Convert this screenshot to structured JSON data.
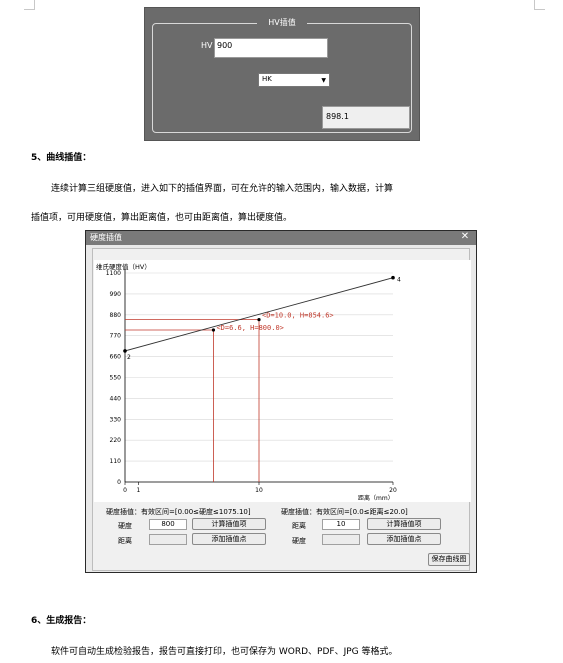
{
  "hv_panel": {
    "frame_title": "HV插值",
    "hv_label": "HV",
    "hv_value": "900",
    "scale_select": "HK",
    "result": "898.1"
  },
  "section5": {
    "heading": "5、曲线插值：",
    "para_line1": "连续计算三组硬度值，进入如下的插值界面，可在允许的输入范围内，输入数据，计算",
    "para_line2": "插值项，可用硬度值，算出距离值，也可由距离值，算出硬度值。"
  },
  "dialog": {
    "title": "硬度插值",
    "close_glyph": "✕",
    "left": {
      "header": "硬度插值：有效区间=[0.00≤硬度≤1075.10]",
      "hardness_label": "硬度",
      "hardness_value": "800",
      "calc_button": "计算插值项",
      "distance_label": "距离",
      "distance_value": "",
      "add_button": "添加插值点"
    },
    "right": {
      "header": "硬度插值：有效区间=[0.0≤距离≤20.0]",
      "distance_label": "距离",
      "distance_value": "10",
      "calc_button": "计算插值项",
      "hardness_label": "硬度",
      "hardness_value": "",
      "add_button": "添加插值点"
    },
    "save_button": "保存曲线图"
  },
  "chart_data": {
    "type": "line",
    "ylabel": "维氏硬度值（HV）",
    "xlabel": "距离（mm）",
    "ylim": [
      0,
      1100
    ],
    "xlim": [
      0,
      20
    ],
    "yticks": [
      "1100",
      "990",
      "880",
      "770",
      "660",
      "550",
      "440",
      "330",
      "220",
      "110",
      "0"
    ],
    "ytick_values": [
      1100,
      990,
      880,
      770,
      660,
      550,
      440,
      330,
      220,
      110,
      0
    ],
    "xticks": [
      "0",
      "1",
      "10",
      "20"
    ],
    "xtick_values": [
      0,
      1,
      10,
      20
    ],
    "series": [
      {
        "points": [
          {
            "x": 0,
            "y": 690,
            "label": "2"
          },
          {
            "x": 20,
            "y": 1075.1,
            "label": "4"
          }
        ]
      }
    ],
    "interpolations": [
      {
        "x": 10.0,
        "y": 854.6,
        "label": "<D=10.0, H=854.6>"
      },
      {
        "x": 6.6,
        "y": 800.0,
        "label": "<D=6.6, H=800.0>"
      }
    ],
    "colors": {
      "curve": "#333333",
      "interp": "#c0392b",
      "grid": "#d8d8d8"
    }
  },
  "section6": {
    "heading": "6、生成报告：",
    "para": "软件可自动生成检验报告，报告可直接打印，也可保存为 WORD、PDF、JPG 等格式。"
  }
}
